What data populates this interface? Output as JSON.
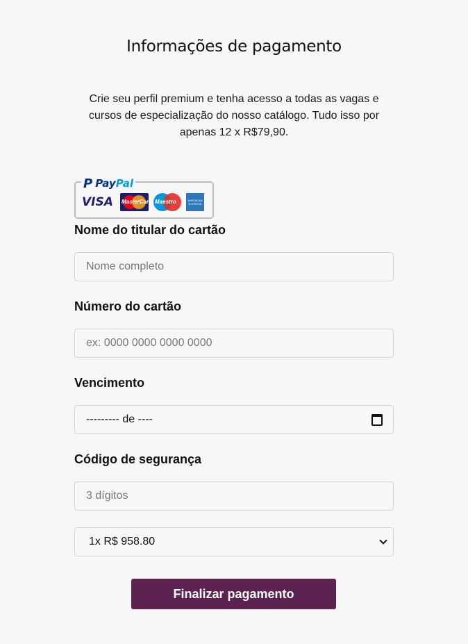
{
  "page": {
    "title": "Informações de pagamento",
    "description": "Crie seu perfil premium e tenha acesso a todas as vagas e cursos de especialização do nosso catálogo. Tudo isso por apenas 12 x R$79,90."
  },
  "payment_badge": {
    "paypal_mark": "P",
    "paypal_word_1": "Pay",
    "paypal_word_2": "Pal",
    "visa": "VISA",
    "mastercard": "MasterCard",
    "maestro": "Maestro",
    "amex": "AMERICAN EXPRESS"
  },
  "form": {
    "name_label": "Nome do titular do cartão",
    "name_placeholder": "Nome completo",
    "card_label": "Número do cartão",
    "card_placeholder": "ex: 0000 0000 0000 0000",
    "expiry_label": "Vencimento",
    "expiry_value": "--------- de ----",
    "cvv_label": "Código de segurança",
    "cvv_placeholder": "3 dígitos",
    "installments_value": "1x R$ 958.80",
    "submit_label": "Finalizar pagamento"
  },
  "colors": {
    "primary_button": "#5c2350",
    "paypal_dark": "#003087",
    "paypal_light": "#009cde"
  }
}
